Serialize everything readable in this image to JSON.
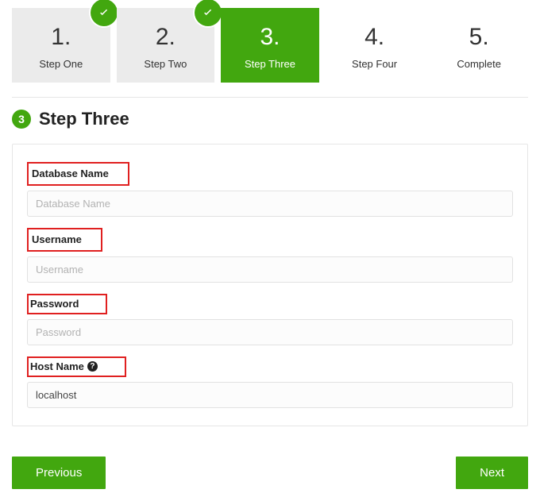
{
  "colors": {
    "accent": "#42a70f",
    "highlight_border": "#e02020"
  },
  "stepper": {
    "items": [
      {
        "num": "1.",
        "label": "Step One",
        "state": "completed"
      },
      {
        "num": "2.",
        "label": "Step Two",
        "state": "completed"
      },
      {
        "num": "3.",
        "label": "Step Three",
        "state": "active"
      },
      {
        "num": "4.",
        "label": "Step Four",
        "state": "future"
      },
      {
        "num": "5.",
        "label": "Complete",
        "state": "future"
      }
    ]
  },
  "section": {
    "circle": "3",
    "title": "Step Three"
  },
  "form": {
    "database_name": {
      "label": "Database Name",
      "placeholder": "Database Name",
      "value": ""
    },
    "username": {
      "label": "Username",
      "placeholder": "Username",
      "value": ""
    },
    "password": {
      "label": "Password",
      "placeholder": "Password",
      "value": ""
    },
    "host_name": {
      "label": "Host Name",
      "placeholder": "",
      "value": "localhost",
      "help_icon": "question-circle-icon"
    }
  },
  "buttons": {
    "previous": "Previous",
    "next": "Next"
  }
}
